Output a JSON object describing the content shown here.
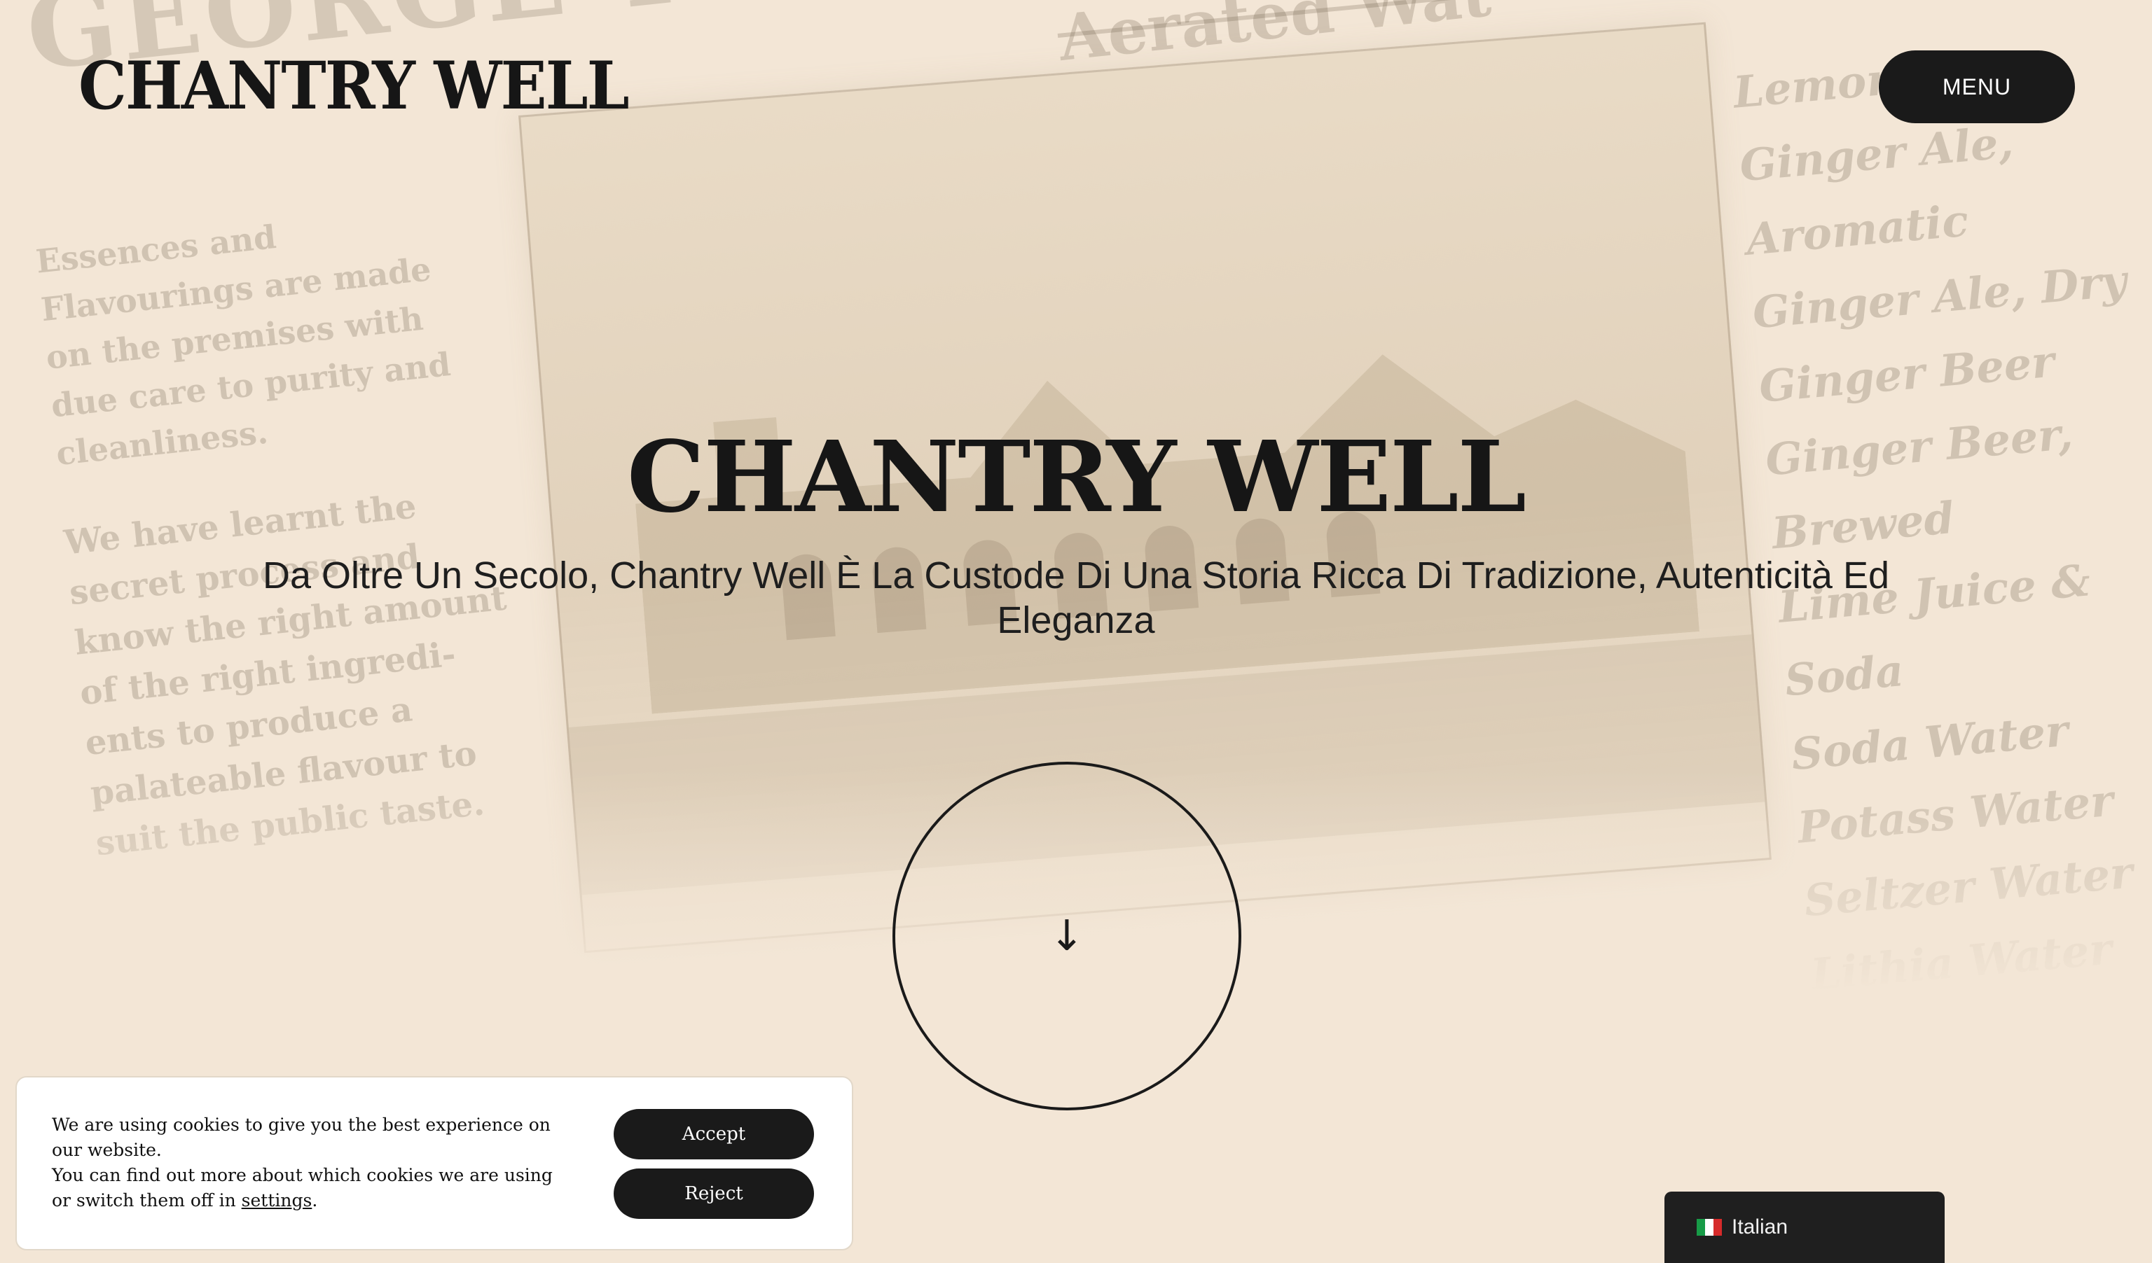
{
  "header": {
    "logo": "CHANTRY WELL",
    "menu_label": "MENU"
  },
  "hero": {
    "title": "CHANTRY WELL",
    "subtitle": "Da Oltre Un Secolo, Chantry Well È La Custode Di Una Storia Ricca Di Tradizione, Autenticità Ed Eleganza",
    "scroll_icon": "arrow-down-icon",
    "scroll_glyph": "↓"
  },
  "background": {
    "header_big": "GEORGE YOUNG,",
    "header_small": "Aerated Wat",
    "left_copy": "Essences and\nFlavourings are made\non the premises with\ndue care to purity and\ncleanliness.",
    "left_copy_2": "We have learnt the\nsecret process and\nknow the right amount\nof the right ingredi-\nents to produce a\npalateable flavour to\nsuit the public taste.",
    "right_list": "Lemonade\nGinger Ale, Aromatic\nGinger Ale, Dry\nGinger Beer\nGinger Beer, Brewed\nLime Juice & Soda\nSoda Water\nPotass Water\nSeltzer Water\nLithia Water\nHop Bitters"
  },
  "cookie_banner": {
    "line1": "We are using cookies to give you the best experience on our website.",
    "line2_prefix": "You can find out more about which cookies we are using or switch them off in ",
    "settings_link": "settings",
    "line2_suffix": ".",
    "accept_label": "Accept",
    "reject_label": "Reject"
  },
  "language_switcher": {
    "flag_icon": "italy-flag-icon",
    "label": "Italian"
  },
  "colors": {
    "background": "#f3e6d6",
    "ink": "#1a1a1a",
    "button_text": "#ffffff"
  }
}
